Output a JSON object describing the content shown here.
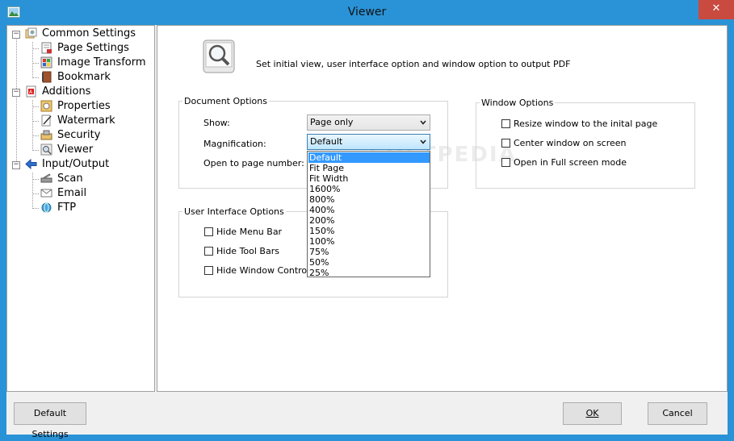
{
  "window": {
    "title": "Viewer",
    "close_glyph": "✕",
    "app_icon": "image-icon"
  },
  "tree": {
    "items": [
      {
        "label": "Common Settings",
        "icon": "settings-stack-icon",
        "level": 0,
        "expanded": true
      },
      {
        "label": "Page Settings",
        "icon": "page-settings-icon",
        "level": 1
      },
      {
        "label": "Image Transform",
        "icon": "image-transform-icon",
        "level": 1
      },
      {
        "label": "Bookmark",
        "icon": "bookmark-icon",
        "level": 1
      },
      {
        "label": "Additions",
        "icon": "pdf-icon",
        "level": 0,
        "expanded": true
      },
      {
        "label": "Properties",
        "icon": "properties-icon",
        "level": 1
      },
      {
        "label": "Watermark",
        "icon": "watermark-icon",
        "level": 1
      },
      {
        "label": "Security",
        "icon": "security-icon",
        "level": 1
      },
      {
        "label": "Viewer",
        "icon": "viewer-icon",
        "level": 1,
        "selected": true
      },
      {
        "label": "Input/Output",
        "icon": "arrow-icon",
        "level": 0,
        "expanded": true
      },
      {
        "label": "Scan",
        "icon": "scanner-icon",
        "level": 1
      },
      {
        "label": "Email",
        "icon": "email-icon",
        "level": 1
      },
      {
        "label": "FTP",
        "icon": "globe-icon",
        "level": 1
      }
    ]
  },
  "panel": {
    "header_icon": "magnifier-icon",
    "description": "Set initial view, user interface option and window option to output PDF",
    "watermark": "SOFTPEDIA"
  },
  "document_options": {
    "title": "Document Options",
    "show_label": "Show:",
    "show_value": "Page only",
    "magnification_label": "Magnification:",
    "magnification_value": "Default",
    "open_page_label": "Open to page number:",
    "magnification_options": [
      "Default",
      "Fit Page",
      "Fit Width",
      "1600%",
      "800%",
      "400%",
      "200%",
      "150%",
      "100%",
      "75%",
      "50%",
      "25%"
    ],
    "selected_option": "Default"
  },
  "ui_options": {
    "title": "User Interface Options",
    "hide_menu_bar": {
      "label": "Hide Menu Bar",
      "checked": false
    },
    "hide_tool_bars": {
      "label": "Hide Tool Bars",
      "checked": false
    },
    "hide_window_controls": {
      "label": "Hide Window Controls",
      "checked": false
    }
  },
  "window_options": {
    "title": "Window Options",
    "resize_window": {
      "label": "Resize window to the inital page",
      "checked": false
    },
    "center_window": {
      "label": "Center window on screen",
      "checked": false
    },
    "full_screen": {
      "label": "Open in Full screen mode",
      "checked": false
    }
  },
  "buttons": {
    "default_settings": "Default Settings",
    "ok": "OK",
    "cancel": "Cancel"
  },
  "colors": {
    "titlebar": "#2a93d7",
    "selection": "#3399ff",
    "close": "#c94a3f"
  }
}
